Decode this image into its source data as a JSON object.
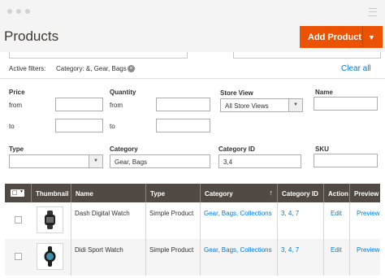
{
  "header": {
    "title": "Products",
    "add_button": "Add Product"
  },
  "active_filters": {
    "label": "Active filters:",
    "value": "Category: &, Gear, Bags",
    "clear_all": "Clear all"
  },
  "filters": {
    "price": {
      "label": "Price",
      "from": "from",
      "to": "to"
    },
    "quantity": {
      "label": "Quantity",
      "from": "from",
      "to": "to"
    },
    "store_view": {
      "label": "Store View",
      "value": "All Store Views"
    },
    "name": {
      "label": "Name"
    },
    "type": {
      "label": "Type",
      "value": ""
    },
    "category": {
      "label": "Category",
      "value": "Gear, Bags"
    },
    "category_id": {
      "label": "Category ID",
      "value": "3,4"
    },
    "sku": {
      "label": "SKU"
    }
  },
  "grid": {
    "columns": [
      "Thumbnail",
      "Name",
      "Type",
      "Category",
      "Category ID",
      "Action",
      "Preview"
    ],
    "rows": [
      {
        "name": "Dash Digital Watch",
        "type": "Simple Product",
        "category": "Gear, Bags, Collections",
        "category_id": "3, 4, 7",
        "action": "Edit",
        "preview": "Preview"
      },
      {
        "name": "Didi Sport Watch",
        "type": "Simple Product",
        "category": "Gear, Bags, Collections",
        "category_id": "3, 4, 7",
        "action": "Edit",
        "preview": "Preview"
      }
    ]
  },
  "colors": {
    "accent": "#eb5202",
    "grid_header": "#514943",
    "link": "#007bdb"
  },
  "icons": {
    "remove": "close-icon",
    "sort": "sort-up-arrow-icon",
    "dropdown": "chevron-down-icon"
  }
}
